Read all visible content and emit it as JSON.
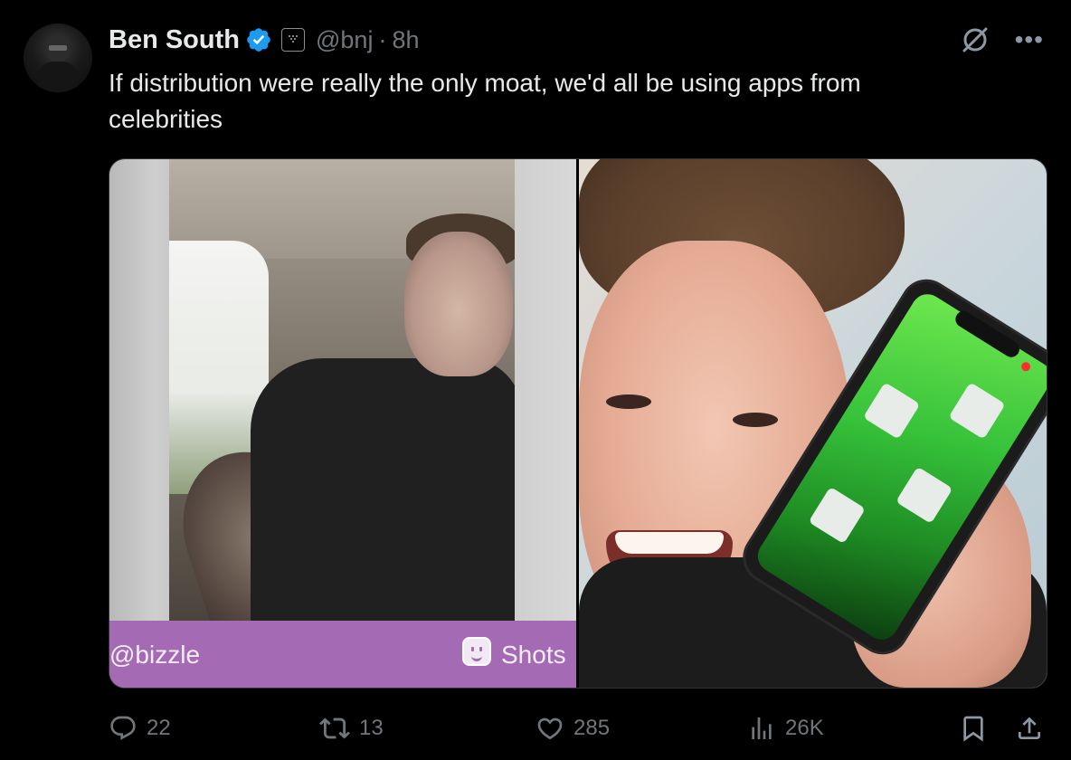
{
  "author": {
    "name": "Ben South",
    "handle": "@bnj",
    "separator": "·",
    "time": "8h"
  },
  "tweet": {
    "text": "If distribution were really the only moat, we'd all be using apps from celebrities"
  },
  "media": {
    "left_overlay_handle": "@bizzle",
    "left_overlay_app": "Shots"
  },
  "actions": {
    "replies": "22",
    "retweets": "13",
    "likes": "285",
    "views": "26K"
  },
  "icons": {
    "verified": "verified-badge-icon",
    "affiliate": "affiliate-badge-icon",
    "grok": "grok-icon",
    "more": "more-icon",
    "reply": "reply-icon",
    "retweet": "retweet-icon",
    "like": "heart-icon",
    "views": "views-icon",
    "bookmark": "bookmark-icon",
    "share": "share-icon"
  },
  "colors": {
    "background": "#000000",
    "text_primary": "#e7e9ea",
    "text_secondary": "#71767b",
    "verified_blue": "#1d9bf0",
    "shots_purple": "#a46ab3"
  }
}
